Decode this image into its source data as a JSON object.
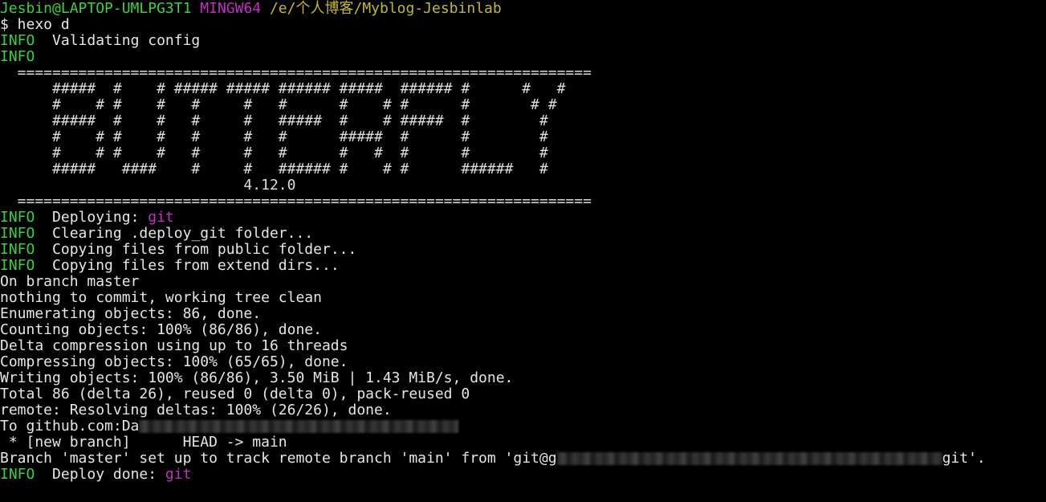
{
  "prompt": {
    "user_host": "Jesbin@LAPTOP-UMLPG3T1",
    "env": "MINGW64",
    "path": "/e/个人博客/Myblog-Jesbinlab"
  },
  "command": "$ hexo d",
  "lines": {
    "info_tag": "INFO",
    "l1": "  Validating config",
    "banner_rule": "  ==================================================================",
    "banner_1": "      #####  #    # ##### ##### ###### #####  ###### #      #   #",
    "banner_2": "      #    # #    #   #     #   #      #    # #      #       # #",
    "banner_3": "      #####  #    #   #     #   #####  #    # #####  #        #",
    "banner_4": "      #    # #    #   #     #   #      #####  #      #        #",
    "banner_5": "      #    # #    #   #     #   #      #   #  #      #        #",
    "banner_6": "      #####   ####    #     #   ###### #    # #      ######   #",
    "version": "                            4.12.0",
    "deploying_text": "  Deploying: ",
    "git_word": "git",
    "clearing": "  Clearing .deploy_git folder...",
    "copy_public": "  Copying files from public folder...",
    "copy_extend": "  Copying files from extend dirs...",
    "on_branch": "On branch master",
    "nothing": "nothing to commit, working tree clean",
    "enumerating": "Enumerating objects: 86, done.",
    "counting": "Counting objects: 100% (86/86), done.",
    "delta": "Delta compression using up to 16 threads",
    "compressing": "Compressing objects: 100% (65/65), done.",
    "writing": "Writing objects: 100% (86/86), 3.50 MiB | 1.43 MiB/s, done.",
    "total": "Total 86 (delta 26), reused 0 (delta 0), pack-reused 0",
    "remote": "remote: Resolving deltas: 100% (26/26), done.",
    "to_prefix": "To github.com:Da",
    "new_branch": " * [new branch]      HEAD -> main",
    "branch_set_prefix": "Branch 'master' set up to track remote branch 'main' from 'git@g",
    "branch_set_suffix": "git'.",
    "deploy_done": "  Deploy done: "
  },
  "colors": {
    "green": "#36d43a",
    "magenta": "#c42ec4",
    "yellow": "#c4b92b",
    "text": "#d3d3d3",
    "background": "#000000"
  }
}
